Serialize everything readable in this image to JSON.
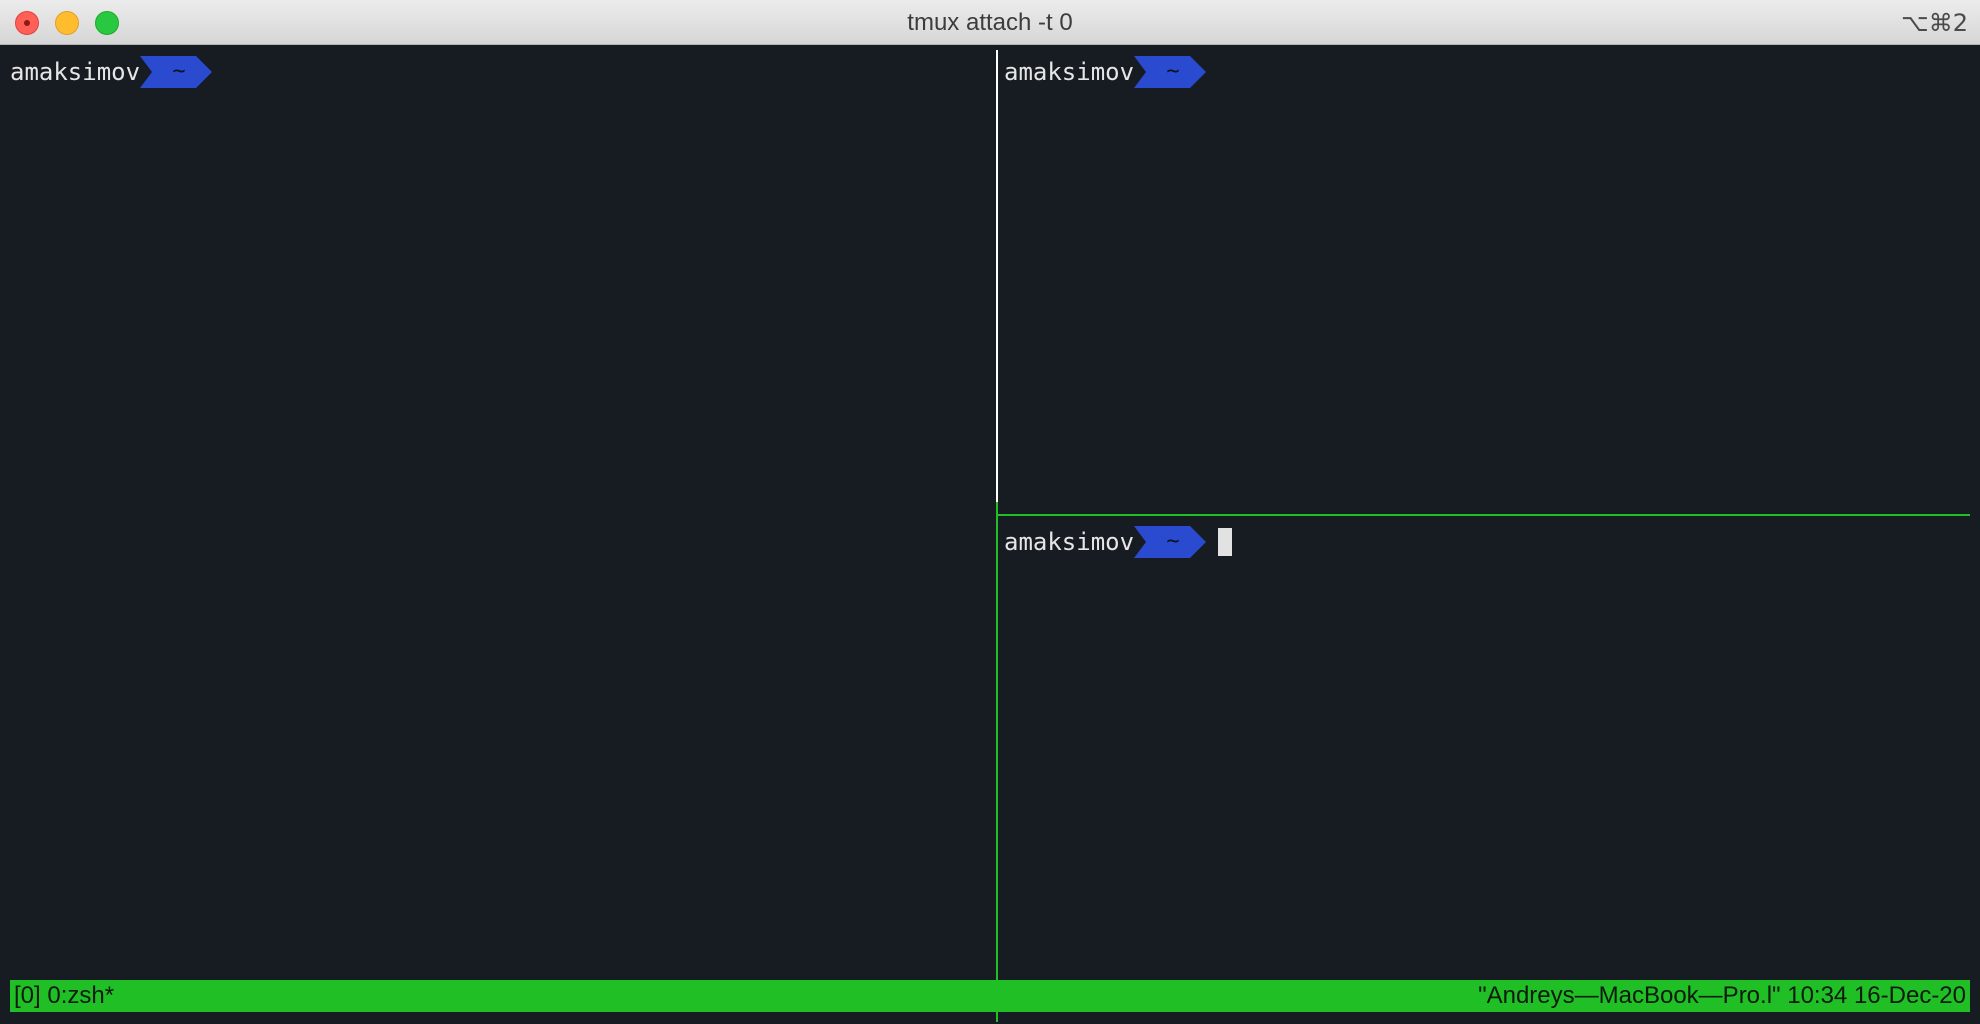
{
  "window": {
    "title": "tmux attach -t 0",
    "shortcut": "⌥⌘2"
  },
  "panes": [
    {
      "user": "amaksimov",
      "dir": "~",
      "active": false
    },
    {
      "user": "amaksimov",
      "dir": "~",
      "active": false
    },
    {
      "user": "amaksimov",
      "dir": "~",
      "active": true
    }
  ],
  "status": {
    "left": "[0] 0:zsh*",
    "right": "\"Andreys—MacBook—Pro.l\" 10:34 16-Dec-20"
  },
  "colors": {
    "background": "#171b22",
    "prompt_dir_bg": "#2a4bd0",
    "status_bar": "#1fbf25",
    "active_border": "#1fbf25",
    "inactive_border": "#ffffff"
  }
}
